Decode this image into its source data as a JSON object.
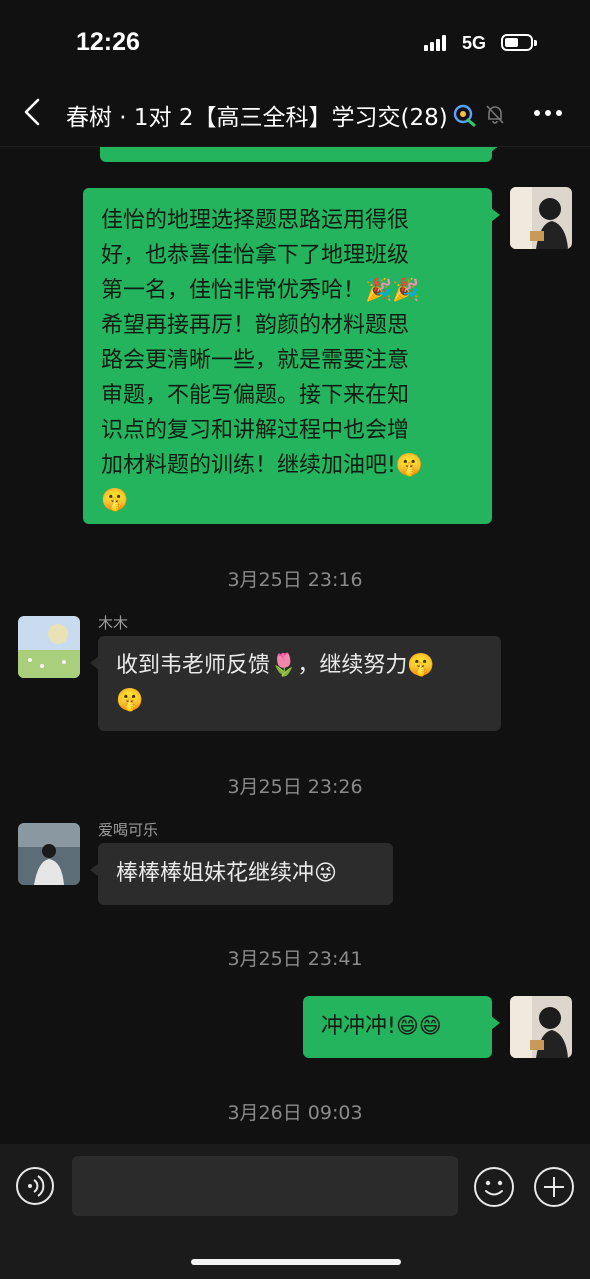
{
  "status_bar": {
    "time": "12:26",
    "network": "5G"
  },
  "header": {
    "back_icon": "chevron-left-icon",
    "title": "春树 · 1对 2【高三全科】学习交(28)",
    "icons": [
      "group-members-icon",
      "bell-muted-icon",
      "more-icon"
    ]
  },
  "messages": [
    {
      "id": "m0",
      "side": "me",
      "text": ""
    },
    {
      "id": "m1",
      "side": "me",
      "text": "佳怡的地理选择题思路运用得很好，也恭喜佳怡拿下了地理班级第一名，佳怡非常优秀哈！🎉🎉希望再接再厉！韵颜的材料题思路会更清晰一些，就是需要注意审题，不能写偏题。接下来在知识点的复习和讲解过程中也会增加材料题的训练！继续加油吧!🤫🤫"
    },
    {
      "id": "t1",
      "type": "time",
      "text": "3月25日 23:16"
    },
    {
      "id": "m2",
      "side": "other",
      "sender": "木木",
      "text": "收到韦老师反馈🌷，继续努力🤫🤫"
    },
    {
      "id": "t2",
      "type": "time",
      "text": "3月25日 23:26"
    },
    {
      "id": "m3",
      "side": "other",
      "sender": "爱喝可乐",
      "text": "棒棒棒姐妹花继续冲😜"
    },
    {
      "id": "t3",
      "type": "time",
      "text": "3月25日 23:41"
    },
    {
      "id": "m4",
      "side": "me",
      "text": "冲冲冲!😄😄"
    },
    {
      "id": "t4",
      "type": "time",
      "text": "3月26日 09:03"
    }
  ],
  "bubble_lines": {
    "m1": [
      "佳怡的地理选择题思路运用得很",
      "好，也恭喜佳怡拿下了地理班级",
      "第一名，佳怡非常优秀哈！🎉🎉",
      "希望再接再厉！韵颜的材料题思",
      "路会更清晰一些，就是需要注意",
      "审题，不能写偏题。接下来在知",
      "识点的复习和讲解过程中也会增",
      "加材料题的训练！继续加油吧!🤫",
      "🤫"
    ],
    "m2": [
      "收到韦老师反馈🌷，继续努力🤫",
      "🤫"
    ]
  },
  "input_bar": {
    "value": "",
    "icons": [
      "voice-icon",
      "emoji-icon",
      "plus-icon"
    ]
  },
  "colors": {
    "background": "#111111",
    "my_bubble": "#24b45e",
    "other_bubble": "#2c2c2c",
    "timestamp": "#8a8a8a"
  }
}
